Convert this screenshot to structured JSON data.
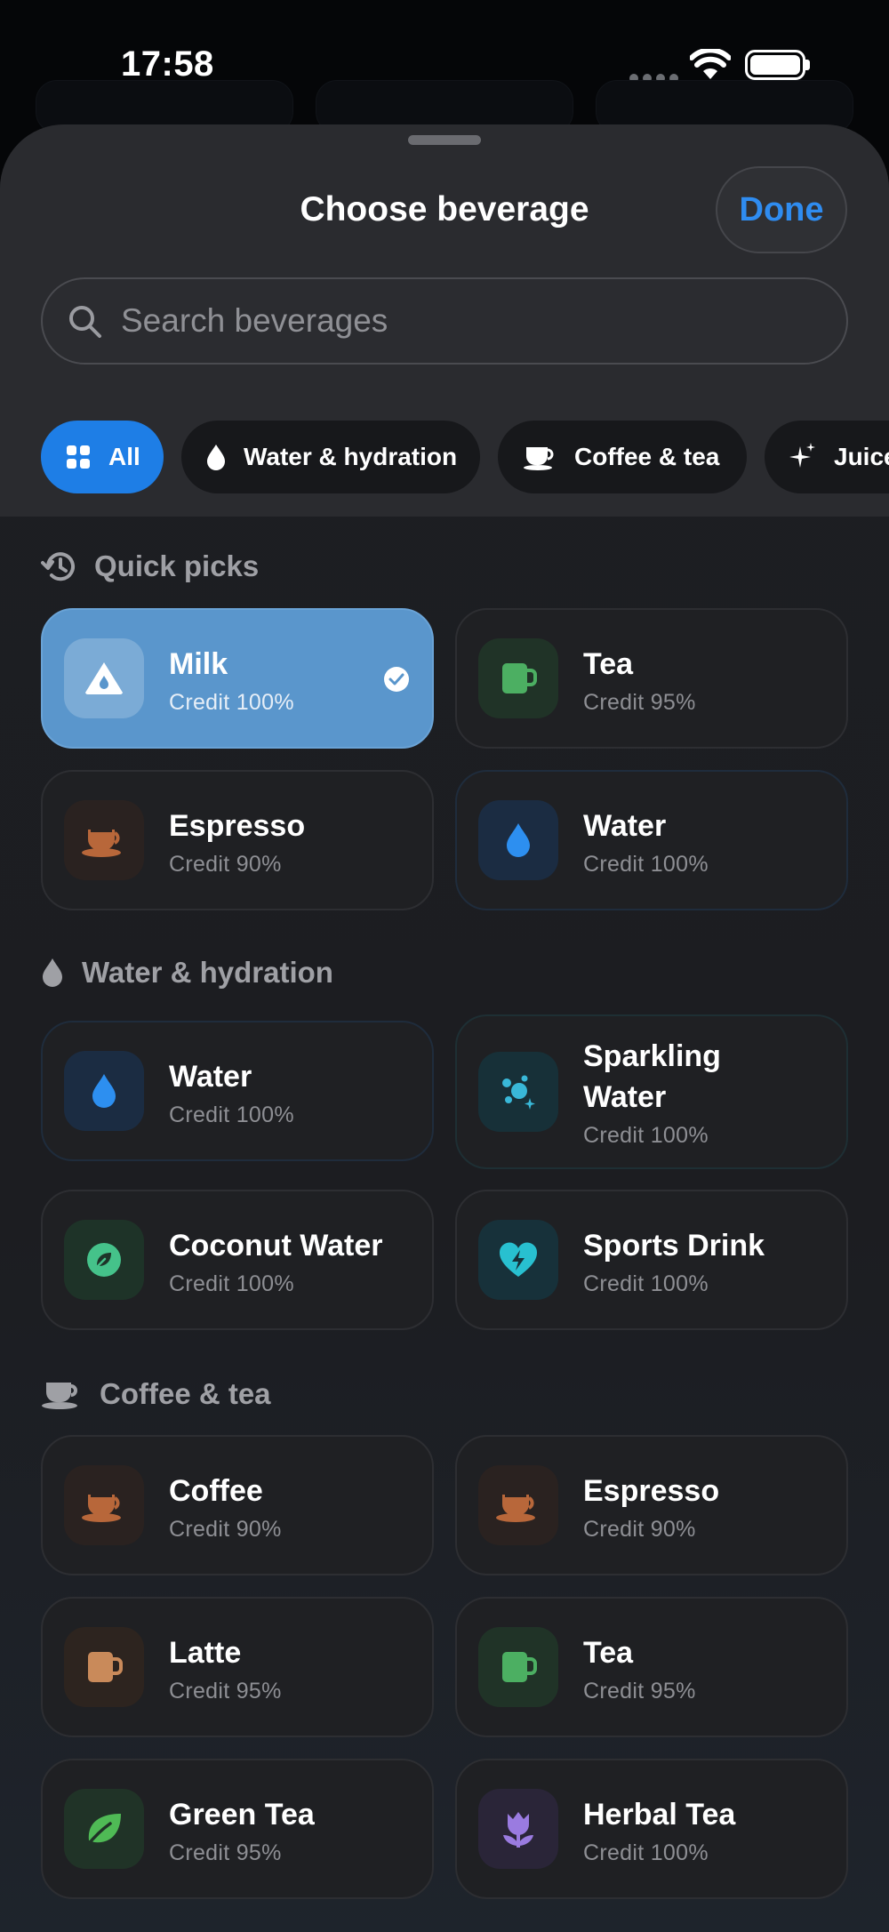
{
  "status_bar": {
    "time": "17:58"
  },
  "sheet": {
    "title": "Choose beverage",
    "done_label": "Done",
    "search_placeholder": "Search beverages"
  },
  "filters": [
    {
      "label": "All",
      "icon": "grid-icon",
      "active": true
    },
    {
      "label": "Water & hydration",
      "icon": "droplet-icon"
    },
    {
      "label": "Coffee & tea",
      "icon": "cup-icon"
    },
    {
      "label": "Juice",
      "icon": "sparkles-icon"
    }
  ],
  "sections": {
    "quick_picks": {
      "title": "Quick picks",
      "icon": "history-icon",
      "items": [
        {
          "name": "Milk",
          "credit": "Credit 100%",
          "icon": "milk-drop-icon",
          "selected": true
        },
        {
          "name": "Tea",
          "credit": "Credit 95%",
          "icon": "mug-icon",
          "color": "#4caf62"
        },
        {
          "name": "Espresso",
          "credit": "Credit 90%",
          "icon": "coffee-cup-icon",
          "color": "#b8673a"
        },
        {
          "name": "Water",
          "credit": "Credit 100%",
          "icon": "droplet-icon",
          "color": "#2d8ff0"
        }
      ]
    },
    "water": {
      "title": "Water & hydration",
      "icon": "droplet-icon",
      "items": [
        {
          "name": "Water",
          "credit": "Credit 100%",
          "icon": "droplet-icon",
          "color": "#2d8ff0"
        },
        {
          "name": "Sparkling",
          "name2": "Water",
          "credit": "Credit 100%",
          "icon": "bubbles-icon",
          "color": "#39b8d8"
        },
        {
          "name": "Coconut Water",
          "credit": "Credit 100%",
          "icon": "leaf-circle-icon",
          "color": "#45c28a"
        },
        {
          "name": "Sports Drink",
          "credit": "Credit 100%",
          "icon": "heart-bolt-icon",
          "color": "#28c0d0"
        }
      ]
    },
    "coffee": {
      "title": "Coffee & tea",
      "icon": "cup-icon",
      "items": [
        {
          "name": "Coffee",
          "credit": "Credit 90%",
          "icon": "coffee-cup-icon",
          "color": "#b8673a"
        },
        {
          "name": "Espresso",
          "credit": "Credit 90%",
          "icon": "coffee-cup-icon",
          "color": "#b8673a"
        },
        {
          "name": "Latte",
          "credit": "Credit 95%",
          "icon": "mug-icon",
          "color": "#c98a5a"
        },
        {
          "name": "Tea",
          "credit": "Credit 95%",
          "icon": "mug-icon",
          "color": "#4caf62"
        },
        {
          "name": "Green Tea",
          "credit": "Credit 95%",
          "icon": "leaf-icon",
          "color": "#4fba55"
        },
        {
          "name": "Herbal Tea",
          "credit": "Credit 100%",
          "icon": "tulip-icon",
          "color": "#9a7be0"
        }
      ]
    }
  }
}
